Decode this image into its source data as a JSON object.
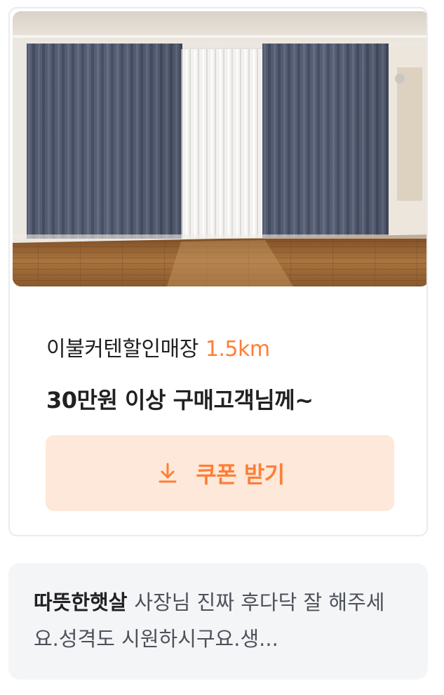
{
  "store_card": {
    "store_name": "이불커텐할인매장",
    "distance": "1.5km",
    "offer_title": "30만원 이상 구매고객님께~",
    "coupon_button_label": "쿠폰 받기",
    "accent_color": "#ff7e36",
    "button_background": "#fde8d9",
    "photo_icon": "curtain-room-photo"
  },
  "review": {
    "author": "따뜻한햇살",
    "text": "사장님 진짜 후다닥 잘 해주세요.성격도 시원하시구요.생..."
  }
}
